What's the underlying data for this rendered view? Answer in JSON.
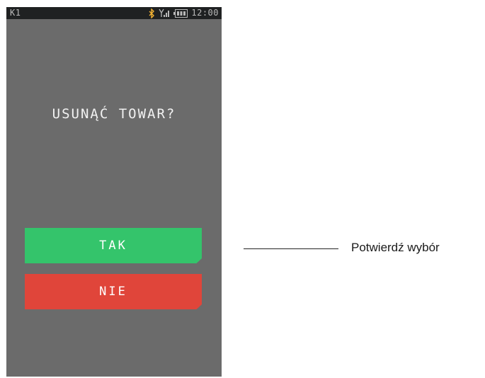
{
  "status_bar": {
    "left_label": "K1",
    "time": "12:00",
    "icons": [
      "bluetooth-icon",
      "signal-icon",
      "battery-icon"
    ],
    "bluetooth_color": "#f2b233"
  },
  "dialog": {
    "question": "USUNĄĆ TOWAR?",
    "yes_label": "TAK",
    "no_label": "NIE",
    "yes_color": "#34c46b",
    "no_color": "#e0453a"
  },
  "callout": {
    "text": "Potwierdź wybór"
  }
}
